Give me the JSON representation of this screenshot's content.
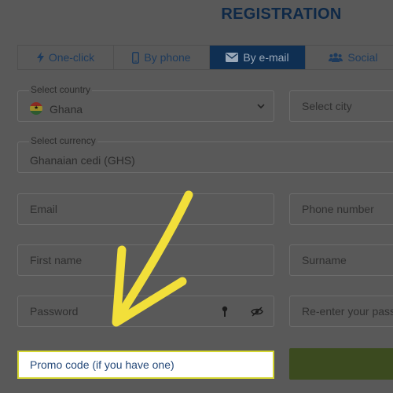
{
  "title": "REGISTRATION",
  "tabs": [
    {
      "label": "One-click",
      "icon": "lightning-icon",
      "active": false
    },
    {
      "label": "By phone",
      "icon": "phone-icon",
      "active": false
    },
    {
      "label": "By e-mail",
      "icon": "envelope-icon",
      "active": true
    },
    {
      "label": "Social",
      "icon": "users-icon",
      "active": false
    }
  ],
  "country": {
    "label": "Select country",
    "value": "Ghana"
  },
  "city": {
    "placeholder": "Select city"
  },
  "currency": {
    "label": "Select currency",
    "value": "Ghanaian cedi (GHS)"
  },
  "email": {
    "placeholder": "Email"
  },
  "phone": {
    "placeholder": "Phone number"
  },
  "first_name": {
    "placeholder": "First name"
  },
  "surname": {
    "placeholder": "Surname"
  },
  "password": {
    "placeholder": "Password"
  },
  "reenter": {
    "placeholder": "Re-enter your pass"
  },
  "promo": {
    "placeholder": "Promo code (if you have one)"
  },
  "colors": {
    "overlay": "#595959",
    "active_tab": "#0f2f52",
    "highlight": "#d4d62f",
    "arrow": "#f2df3a"
  }
}
